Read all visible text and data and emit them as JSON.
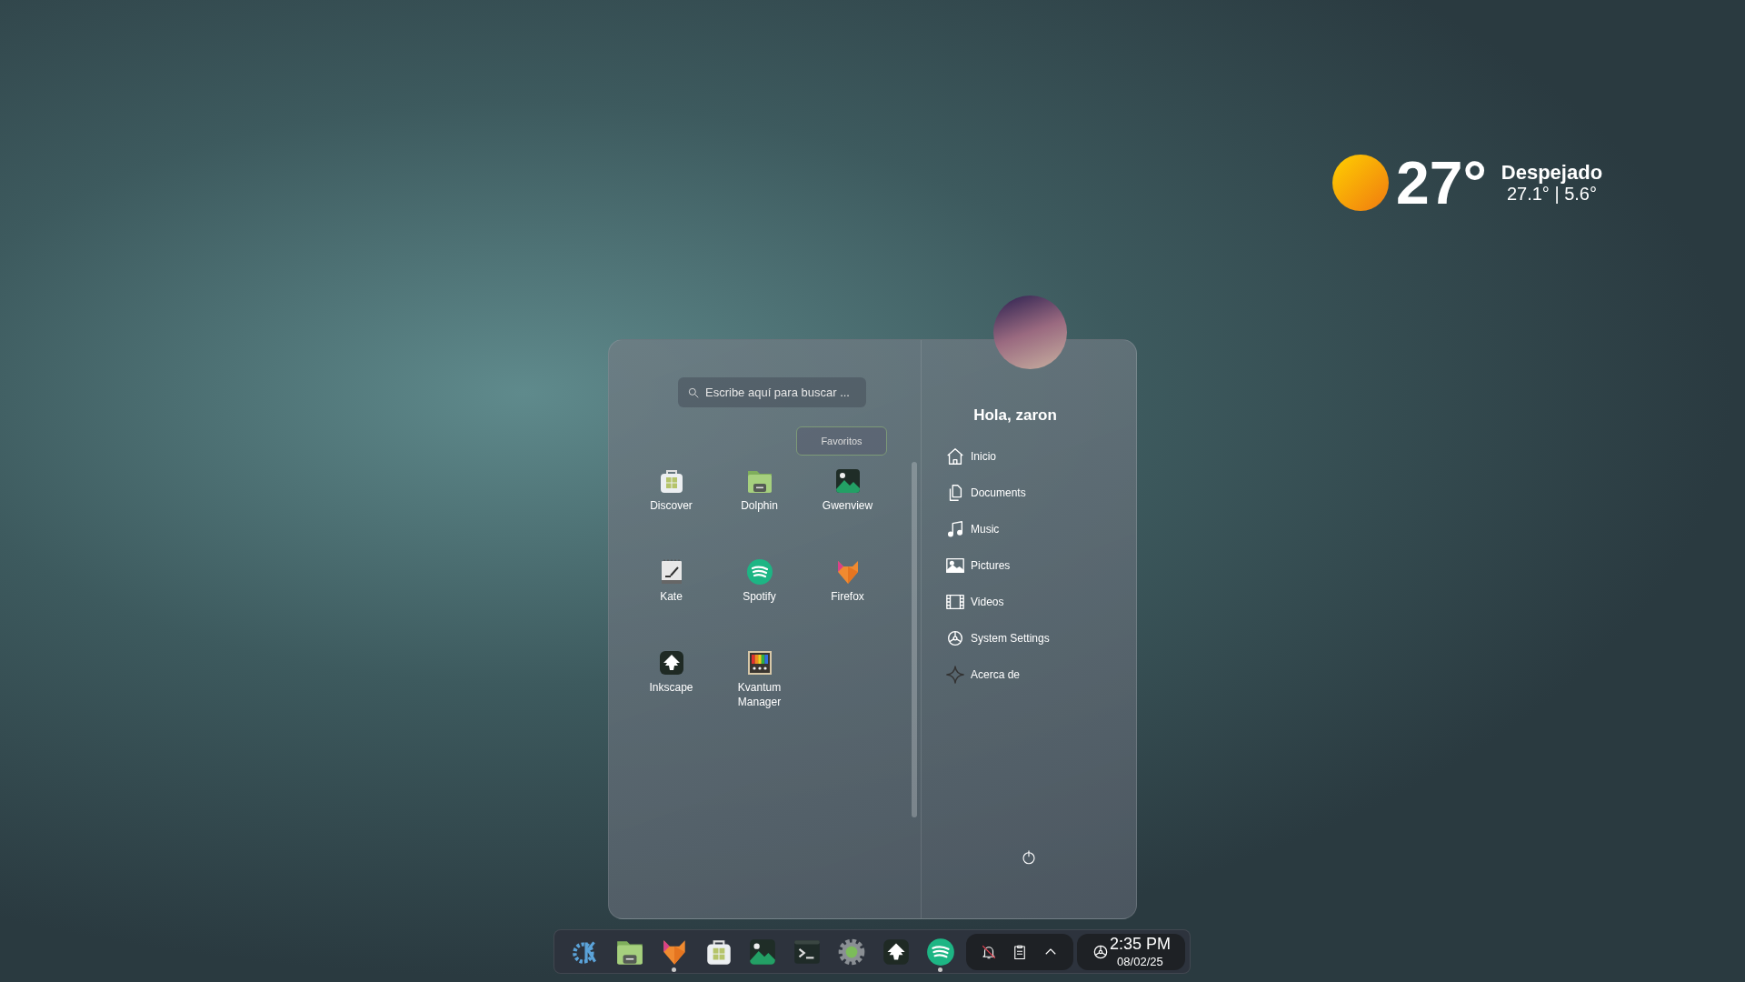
{
  "weather": {
    "temperature": "27°",
    "condition": "Despejado",
    "range": "27.1° | 5.6°"
  },
  "launcher": {
    "search": {
      "placeholder": "Escribe aquí para buscar ..."
    },
    "category": {
      "label": "Favoritos",
      "selected": true
    },
    "apps": [
      {
        "name": "Discover",
        "kind": "store"
      },
      {
        "name": "Dolphin",
        "kind": "folder"
      },
      {
        "name": "Gwenview",
        "kind": "image"
      },
      {
        "name": "Kate",
        "kind": "editor"
      },
      {
        "name": "Spotify",
        "kind": "stream"
      },
      {
        "name": "Firefox",
        "kind": "fox"
      },
      {
        "name": "Inkscape",
        "kind": "vector"
      },
      {
        "name": "Kvantum Manager",
        "kind": "palette"
      }
    ],
    "greeting": "Hola, zaron",
    "places": [
      {
        "label": "Inicio",
        "kind": "home"
      },
      {
        "label": "Documents",
        "kind": "documents"
      },
      {
        "label": "Music",
        "kind": "music"
      },
      {
        "label": "Pictures",
        "kind": "pictures"
      },
      {
        "label": "Videos",
        "kind": "videos"
      },
      {
        "label": "System Settings",
        "kind": "settings"
      },
      {
        "label": "Acerca de",
        "kind": "about"
      }
    ]
  },
  "taskbar": {
    "apps": [
      {
        "kind": "kde",
        "running": false
      },
      {
        "kind": "folder",
        "running": false
      },
      {
        "kind": "fox",
        "running": true
      },
      {
        "kind": "store",
        "running": false
      },
      {
        "kind": "image",
        "running": false
      },
      {
        "kind": "terminal",
        "running": false
      },
      {
        "kind": "gear",
        "running": false
      },
      {
        "kind": "vector",
        "running": false
      },
      {
        "kind": "stream",
        "running": true
      }
    ],
    "clock": {
      "time": "2:35 PM",
      "date": "08/02/25"
    }
  }
}
